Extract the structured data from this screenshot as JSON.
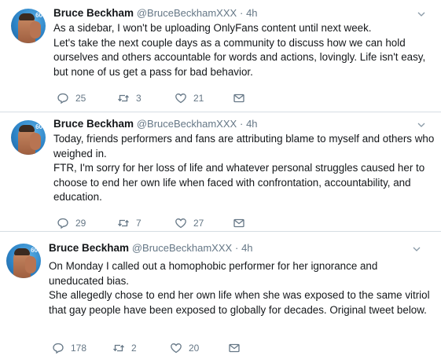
{
  "tweets": [
    {
      "name": "Bruce Beckham",
      "handle": "@BruceBeckhamXXX",
      "sep": "·",
      "time": "4h",
      "paragraphs": [
        "As a sidebar, I won't be uploading OnlyFans content until next week.",
        "Let's take the next couple days as a community to discuss how we can hold ourselves and others accountable for words and actions, lovingly.  Life isn't easy, but none of us get a pass for bad behavior."
      ],
      "replies": "25",
      "retweets": "3",
      "likes": "21"
    },
    {
      "name": "Bruce Beckham",
      "handle": "@BruceBeckhamXXX",
      "sep": "·",
      "time": "4h",
      "paragraphs": [
        "Today, friends performers and fans are attributing blame to myself and others who weighed in.",
        "FTR, I'm sorry for her loss of life and whatever personal struggles caused her to choose to end her own life when faced with confrontation, accountability, and education."
      ],
      "replies": "29",
      "retweets": "7",
      "likes": "27"
    },
    {
      "name": "Bruce Beckham",
      "handle": "@BruceBeckhamXXX",
      "sep": "·",
      "time": "4h",
      "paragraphs": [
        "On Monday I called out a homophobic performer for her ignorance and uneducated bias.",
        "She allegedly chose to end her own life when she was exposed to the same vitriol that gay people have been exposed to globally for decades.  Original tweet below."
      ],
      "replies": "178",
      "retweets": "2",
      "likes": "20"
    }
  ],
  "icons": {
    "caret": "chevron-down-icon",
    "reply": "reply-icon",
    "retweet": "retweet-icon",
    "like": "heart-icon",
    "dm": "envelope-icon",
    "avatar_mark": "60"
  },
  "colors": {
    "text": "#14171a",
    "muted": "#657786",
    "divider": "#d6dde3"
  }
}
